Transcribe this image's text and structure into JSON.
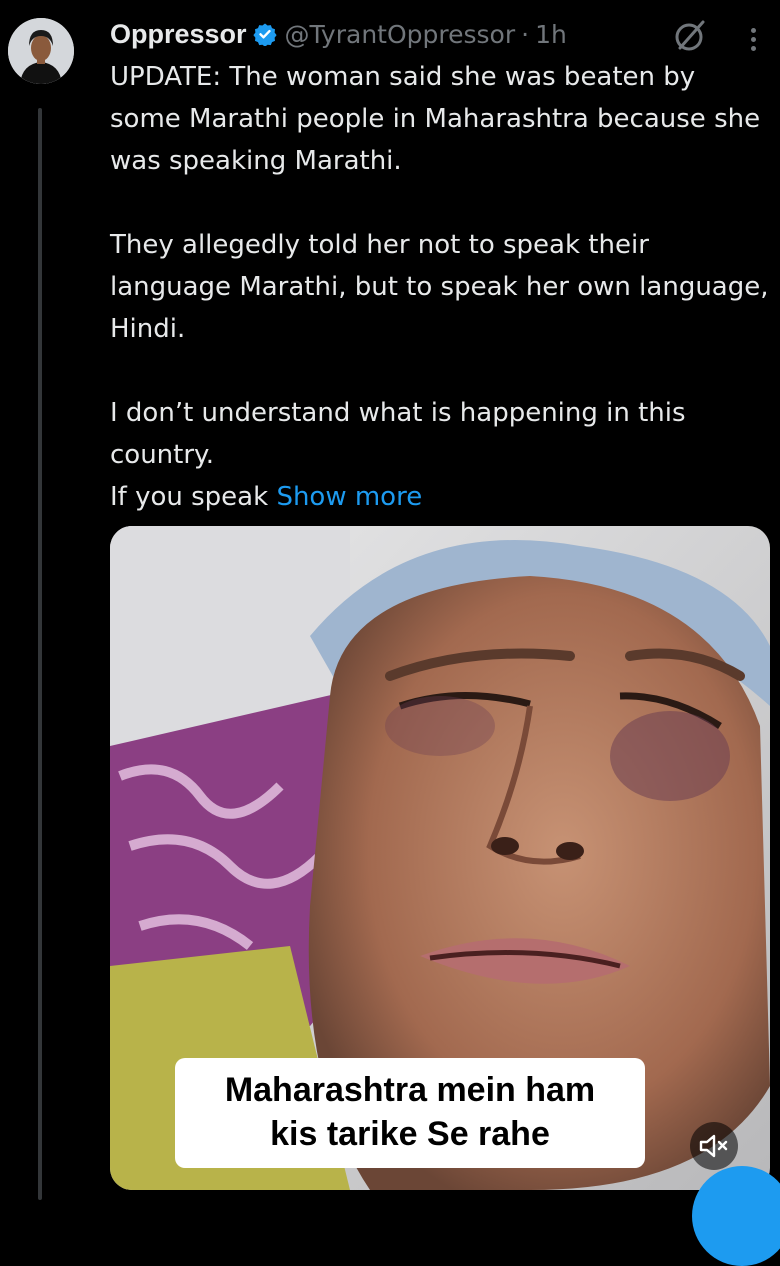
{
  "tweet": {
    "author": {
      "display_name": "Oppressor",
      "handle": "@TyrantOppressor",
      "verified": true,
      "avatar_icon": "profile-photo"
    },
    "separator": "·",
    "time": "1h",
    "text": [
      "UPDATE: The woman said she was beaten by some Marathi people in Maharashtra because she was speaking Marathi.",
      "They allegedly told her not to speak their language Marathi, but to speak her own language, Hindi.",
      "I don’t understand what is happening in this country.",
      "If you speak"
    ],
    "show_more_label": "Show more",
    "media": {
      "caption_line1": "Maharashtra mein ham",
      "caption_line2": "kis tarike Se rahe",
      "mute_icon": "speaker-muted-icon"
    }
  },
  "colors": {
    "background": "#000000",
    "text": "#e7e9ea",
    "muted": "#71767b",
    "accent": "#1d9bf0",
    "thread_line": "#333639"
  }
}
